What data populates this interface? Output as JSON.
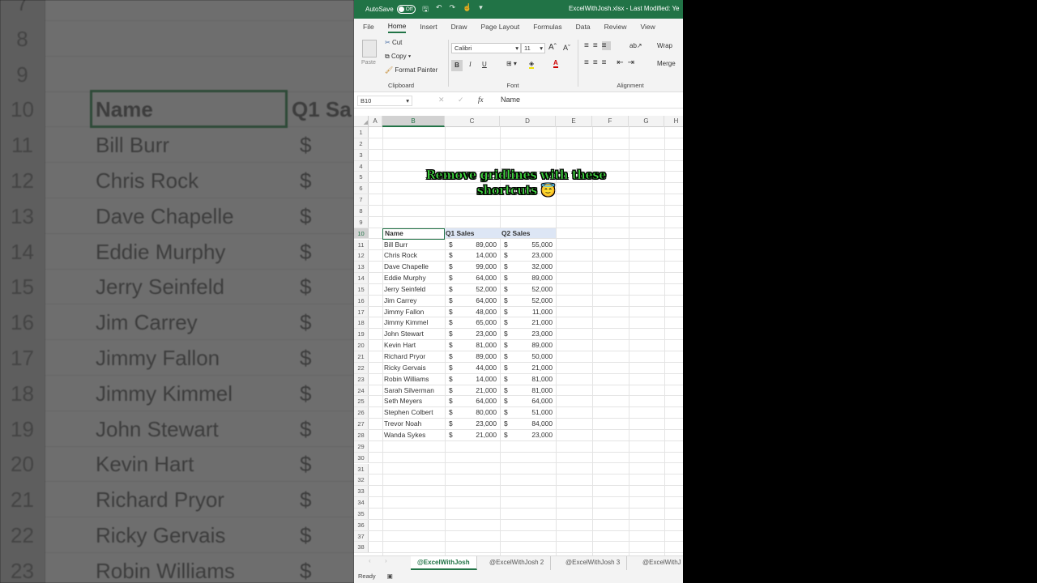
{
  "title_bar": {
    "autosave_label": "AutoSave",
    "autosave_state": "Off",
    "file_title": "ExcelWithJosh.xlsx  -  Last Modified: Ye"
  },
  "menu": [
    "File",
    "Home",
    "Insert",
    "Draw",
    "Page Layout",
    "Formulas",
    "Data",
    "Review",
    "View"
  ],
  "ribbon": {
    "clipboard": {
      "paste": "Paste",
      "cut": "Cut",
      "copy": "Copy",
      "format_painter": "Format Painter",
      "label": "Clipboard"
    },
    "font": {
      "name": "Calibri",
      "size": "11",
      "bold": "B",
      "italic": "I",
      "underline": "U",
      "label": "Font"
    },
    "alignment": {
      "wrap": "Wrap",
      "merge": "Merge",
      "label": "Alignment"
    }
  },
  "formula_bar": {
    "name_box": "B10",
    "fx": "fx",
    "value": "Name"
  },
  "columns": [
    "A",
    "B",
    "C",
    "D",
    "E",
    "F",
    "G",
    "H"
  ],
  "caption": "Remove gridlines with these shortcuts 😇",
  "table": {
    "header_row": 10,
    "headers": [
      "Name",
      "Q1 Sales",
      "Q2 Sales"
    ],
    "currency": "$",
    "rows": [
      [
        "Bill Burr",
        "89,000",
        "55,000"
      ],
      [
        "Chris Rock",
        "14,000",
        "23,000"
      ],
      [
        "Dave Chapelle",
        "99,000",
        "32,000"
      ],
      [
        "Eddie Murphy",
        "64,000",
        "89,000"
      ],
      [
        "Jerry Seinfeld",
        "52,000",
        "52,000"
      ],
      [
        "Jim Carrey",
        "64,000",
        "52,000"
      ],
      [
        "Jimmy Fallon",
        "48,000",
        "11,000"
      ],
      [
        "Jimmy Kimmel",
        "65,000",
        "21,000"
      ],
      [
        "John Stewart",
        "23,000",
        "23,000"
      ],
      [
        "Kevin Hart",
        "81,000",
        "89,000"
      ],
      [
        "Richard Pryor",
        "89,000",
        "50,000"
      ],
      [
        "Ricky Gervais",
        "44,000",
        "21,000"
      ],
      [
        "Robin Williams",
        "14,000",
        "81,000"
      ],
      [
        "Sarah Silverman",
        "21,000",
        "81,000"
      ],
      [
        "Seth Meyers",
        "64,000",
        "64,000"
      ],
      [
        "Stephen Colbert",
        "80,000",
        "51,000"
      ],
      [
        "Trevor Noah",
        "23,000",
        "84,000"
      ],
      [
        "Wanda Sykes",
        "21,000",
        "23,000"
      ]
    ]
  },
  "sheet_tabs": [
    "@ExcelWithJosh",
    "@ExcelWithJosh 2",
    "@ExcelWithJosh 3",
    "@ExcelWithJ"
  ],
  "status": "Ready",
  "background": {
    "rows": [
      "7",
      "8",
      "9",
      "10",
      "11",
      "12",
      "13",
      "14",
      "15",
      "16",
      "17",
      "18",
      "19",
      "20",
      "21",
      "22",
      "23"
    ],
    "names": [
      "",
      "",
      "",
      "Name",
      "Bill Burr",
      "Chris Rock",
      "Dave Chapelle",
      "Eddie Murphy",
      "Jerry Seinfeld",
      "Jim Carrey",
      "Jimmy Fallon",
      "Jimmy Kimmel",
      "John Stewart",
      "Kevin Hart",
      "Richard Pryor",
      "Ricky Gervais",
      "Robin Williams"
    ],
    "header_c": "Q1 Sa"
  }
}
